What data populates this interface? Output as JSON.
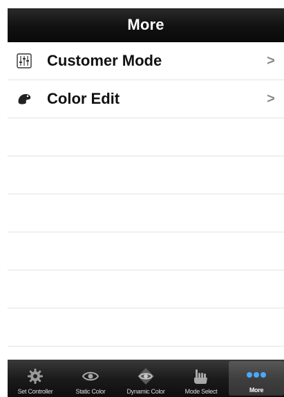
{
  "nav": {
    "title": "More"
  },
  "list": {
    "items": [
      {
        "label": "Customer Mode",
        "icon": "equalizer-icon"
      },
      {
        "label": "Color Edit",
        "icon": "palette-icon"
      }
    ],
    "chevron": ">"
  },
  "tab_bar": {
    "tabs": [
      {
        "label": "Set Controller",
        "icon": "gear-icon",
        "active": false
      },
      {
        "label": "Static Color",
        "icon": "eye-icon",
        "active": false
      },
      {
        "label": "Dynamic Color",
        "icon": "dynamic-eye-icon",
        "active": false
      },
      {
        "label": "Mode Select",
        "icon": "hand-icon",
        "active": false
      },
      {
        "label": "More",
        "icon": "more-dots-icon",
        "active": true
      }
    ]
  }
}
